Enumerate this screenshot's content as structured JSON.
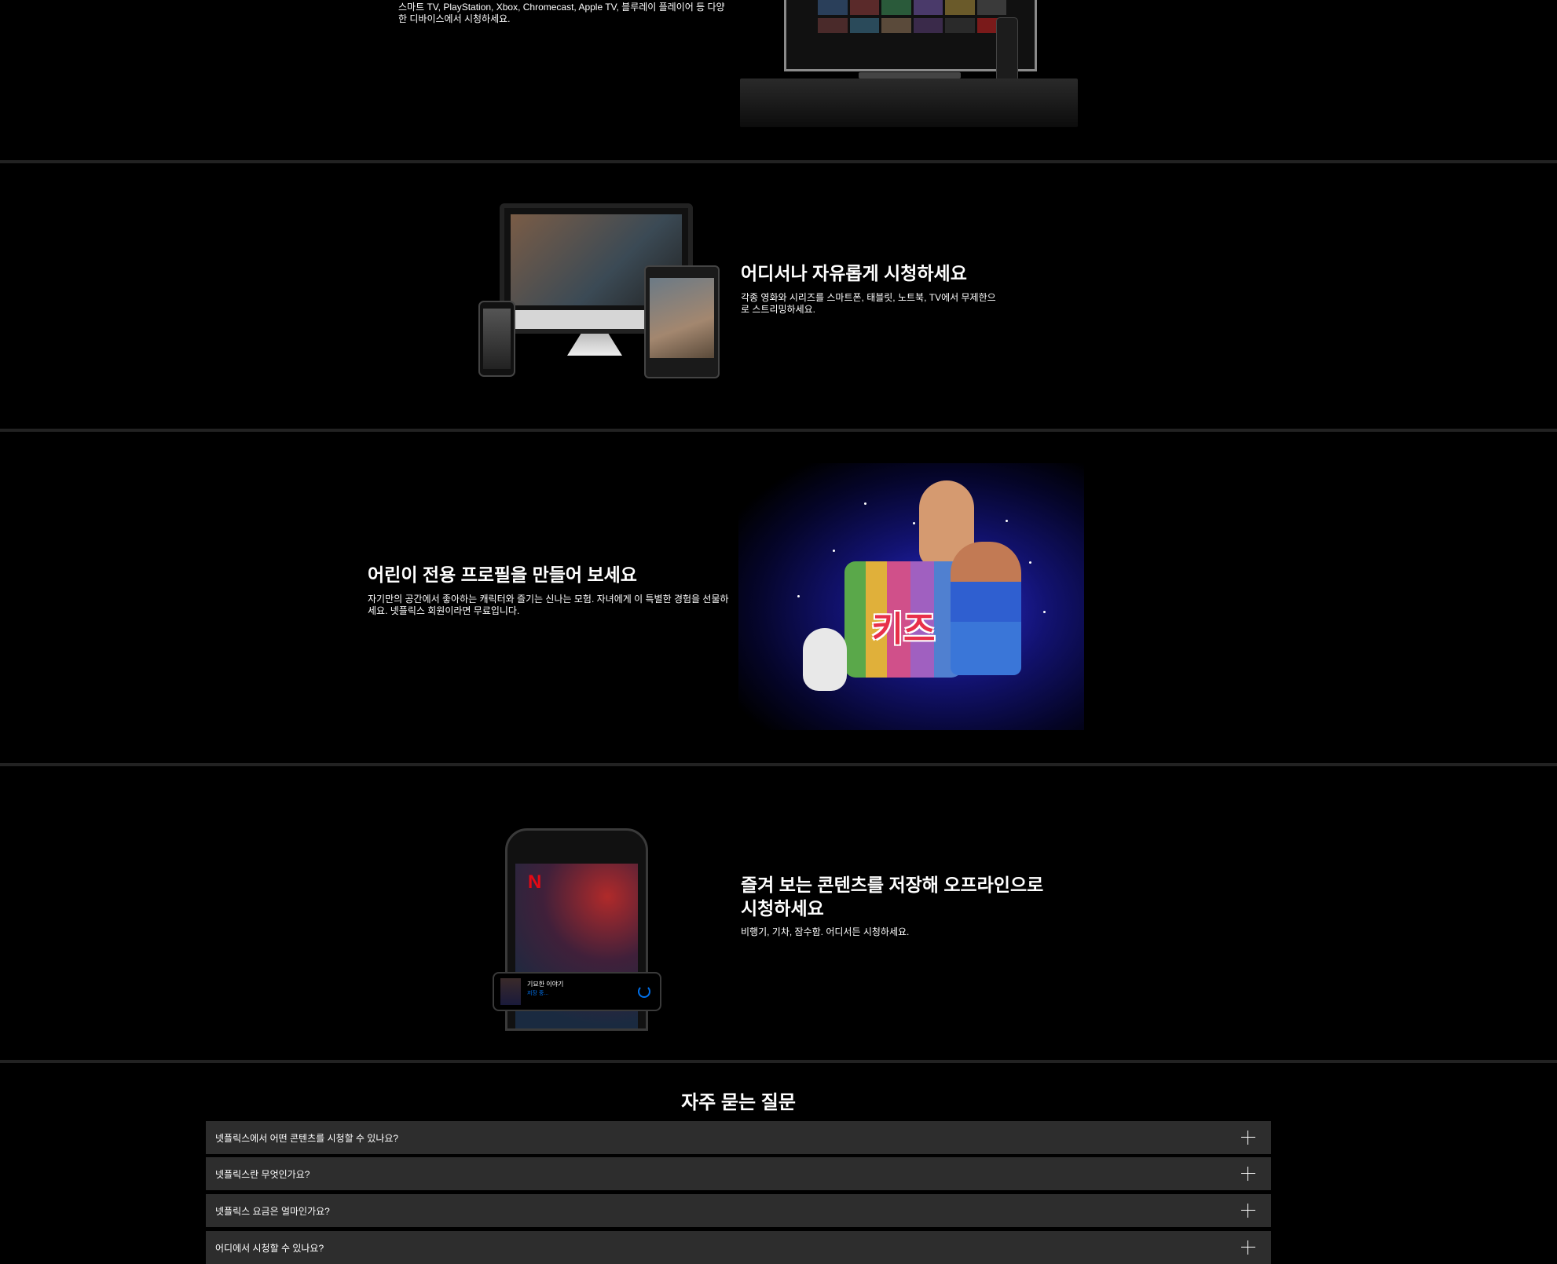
{
  "tv_section": {
    "desc": "스마트 TV, PlayStation, Xbox, Chromecast, Apple TV, 블루레이 플레이어 등 다양한 디바이스에서 시청하세요."
  },
  "anywhere_section": {
    "title": "어디서나 자유롭게 시청하세요",
    "desc": "각종 영화와 시리즈를 스마트폰, 태블릿, 노트북, TV에서 무제한으로 스트리밍하세요."
  },
  "kids_section": {
    "title": "어린이 전용 프로필을 만들어 보세요",
    "desc": "자기만의 공간에서 좋아하는 캐릭터와 즐기는 신나는 모험. 자녀에게 이 특별한 경험을 선물하세요. 넷플릭스 회원이라면 무료입니다.",
    "image_label": "키즈"
  },
  "download_section": {
    "title": "즐겨 보는 콘텐츠를 저장해 오프라인으로 시청하세요",
    "desc": "비행기, 기차, 잠수함. 어디서든 시청하세요.",
    "card_title": "기묘한 이야기",
    "card_status": "저장 중..."
  },
  "faq": {
    "title": "자주 묻는 질문",
    "items": [
      {
        "question": "넷플릭스에서 어떤 콘텐츠를 시청할 수 있나요?"
      },
      {
        "question": "넷플릭스란 무엇인가요?"
      },
      {
        "question": "넷플릭스 요금은 얼마인가요?"
      },
      {
        "question": "어디에서 시청할 수 있나요?"
      }
    ]
  },
  "colors": {
    "background": "#000000",
    "divider": "#222222",
    "faq_item_bg": "#2d2d2d",
    "netflix_red": "#e50914",
    "accent_blue": "#0071eb"
  }
}
